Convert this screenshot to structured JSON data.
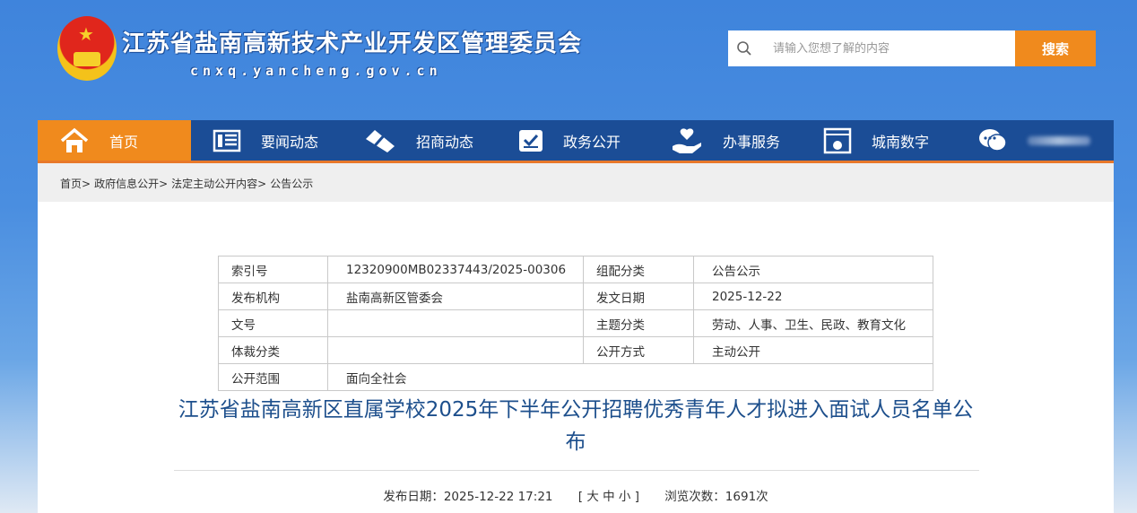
{
  "header": {
    "title": "江苏省盐南高新技术产业开发区管理委员会",
    "domain": "cnxq.yancheng.gov.cn",
    "search_placeholder": "请输入您想了解的内容",
    "search_button": "搜索"
  },
  "nav": [
    {
      "label": "首页",
      "icon": "home-icon"
    },
    {
      "label": "要闻动态",
      "icon": "news-icon"
    },
    {
      "label": "招商动态",
      "icon": "handshake-icon"
    },
    {
      "label": "政务公开",
      "icon": "check-doc-icon"
    },
    {
      "label": "办事服务",
      "icon": "service-hand-icon"
    },
    {
      "label": "城南数字",
      "icon": "data-window-icon"
    },
    {
      "label": "",
      "icon": "chat-icon"
    }
  ],
  "breadcrumb": [
    "首页>",
    "政府信息公开>",
    "法定主动公开内容>",
    "公告公示"
  ],
  "info_table": [
    [
      "索引号",
      "12320900MB02337443/2025-00306",
      "组配分类",
      "公告公示"
    ],
    [
      "发布机构",
      "盐南高新区管委会",
      "发文日期",
      "2025-12-22"
    ],
    [
      "文号",
      "",
      "主题分类",
      "劳动、人事、卫生、民政、教育文化"
    ],
    [
      "体裁分类",
      "",
      "公开方式",
      "主动公开"
    ],
    [
      "公开范围",
      "面向全社会"
    ]
  ],
  "article": {
    "title": "江苏省盐南高新区直属学校2025年下半年公开招聘优秀青年人才拟进入面试人员名单公布",
    "publish": "发布日期：2025-12-22 17:21",
    "font_size": "[ 大 中 小 ]",
    "views": "浏览次数：1691次"
  }
}
